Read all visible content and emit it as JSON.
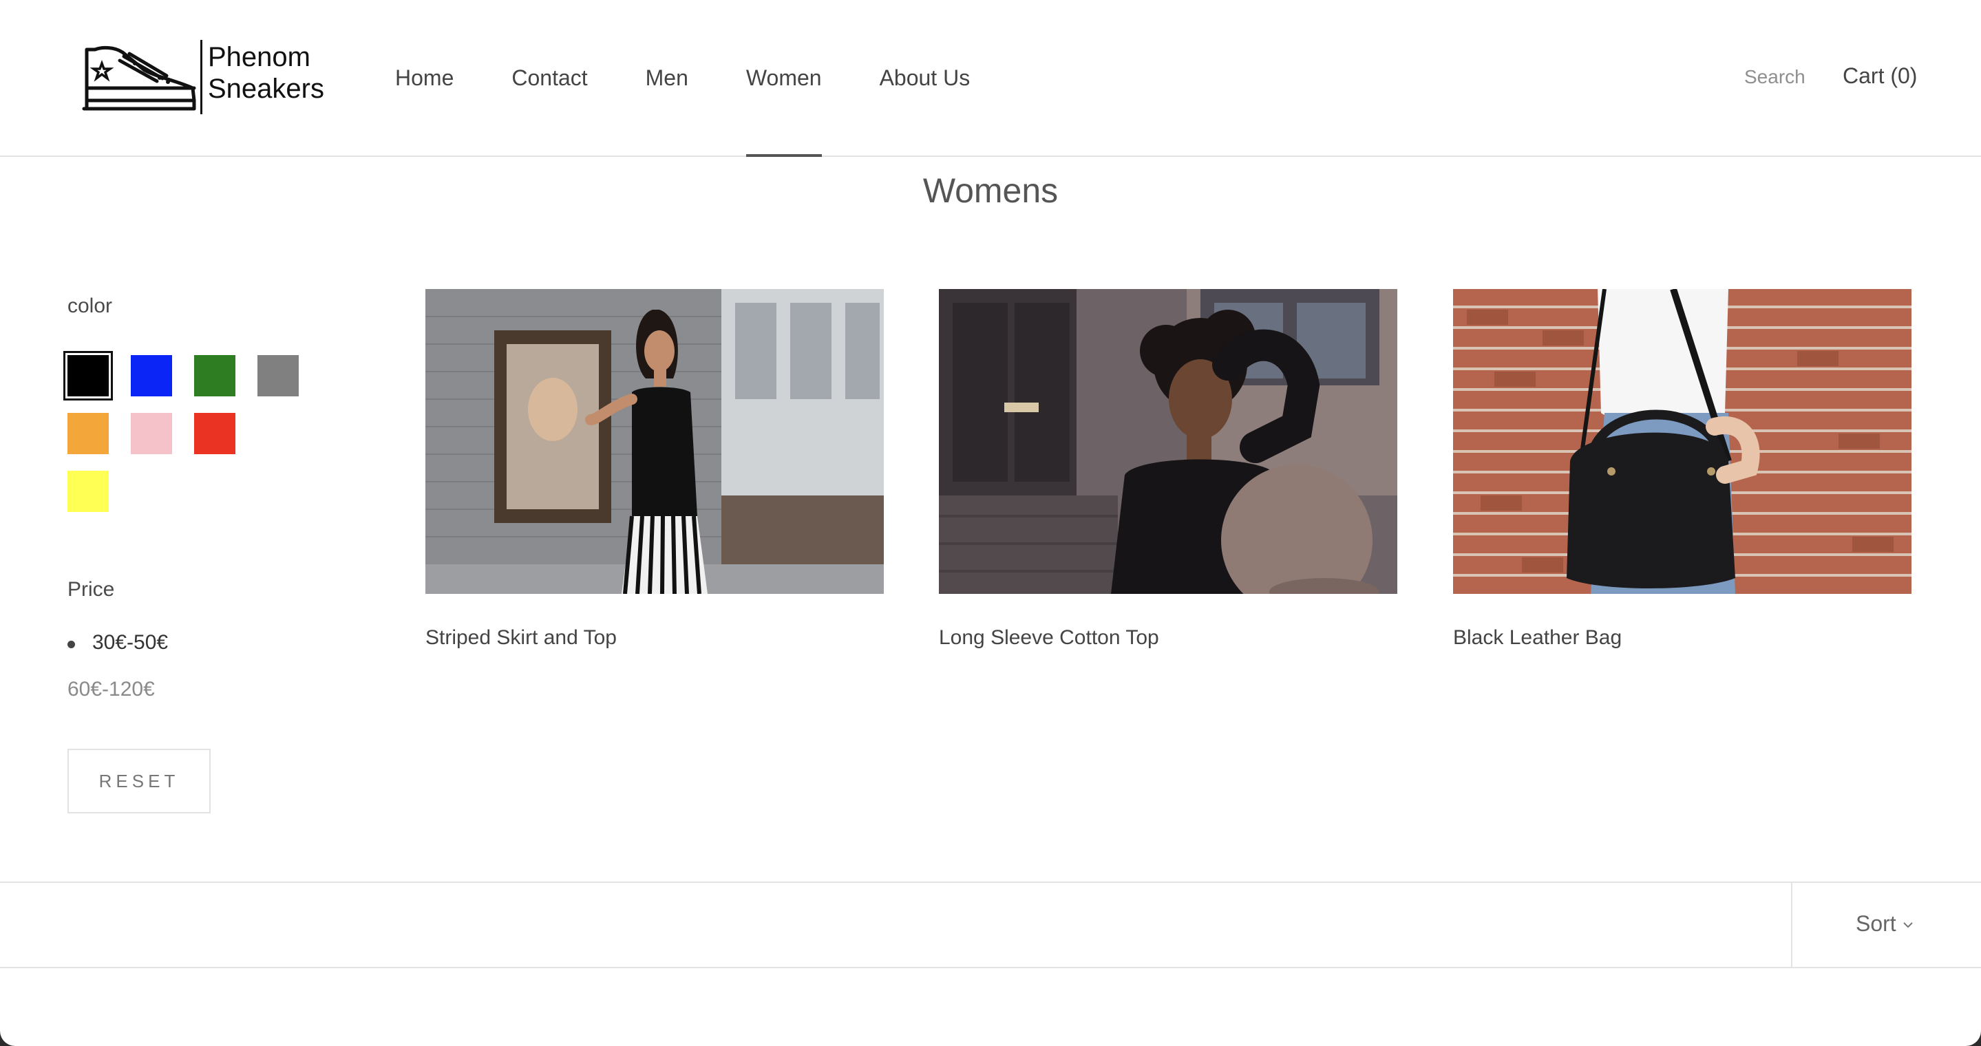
{
  "brand": {
    "line1": "Phenom",
    "line2": "Sneakers",
    "logo_icon": "sneaker-icon"
  },
  "nav": {
    "items": [
      {
        "label": "Home",
        "active": false
      },
      {
        "label": "Contact",
        "active": false
      },
      {
        "label": "Men",
        "active": false
      },
      {
        "label": "Women",
        "active": true
      },
      {
        "label": "About Us",
        "active": false
      }
    ],
    "search_label": "Search",
    "cart_label": "Cart (0)"
  },
  "page_title": "Womens",
  "filters": {
    "color_title": "color",
    "colors": [
      {
        "name": "black",
        "hex": "#000000",
        "selected": true
      },
      {
        "name": "blue",
        "hex": "#0a25f5",
        "selected": false
      },
      {
        "name": "green",
        "hex": "#2e7d22",
        "selected": false
      },
      {
        "name": "gray",
        "hex": "#808080",
        "selected": false
      },
      {
        "name": "orange",
        "hex": "#f3a73b",
        "selected": false
      },
      {
        "name": "pink",
        "hex": "#f6c2c9",
        "selected": false
      },
      {
        "name": "red",
        "hex": "#ea3323",
        "selected": false
      },
      {
        "name": "yellow",
        "hex": "#ffff54",
        "selected": false
      }
    ],
    "price_title": "Price",
    "price_options": [
      {
        "label": "30€-50€",
        "selected": true
      },
      {
        "label": "60€-120€",
        "selected": false
      }
    ],
    "reset_label": "RESET"
  },
  "products": [
    {
      "name": "Striped Skirt and Top"
    },
    {
      "name": "Long Sleeve Cotton Top"
    },
    {
      "name": "Black Leather Bag"
    }
  ],
  "sort": {
    "label": "Sort"
  }
}
